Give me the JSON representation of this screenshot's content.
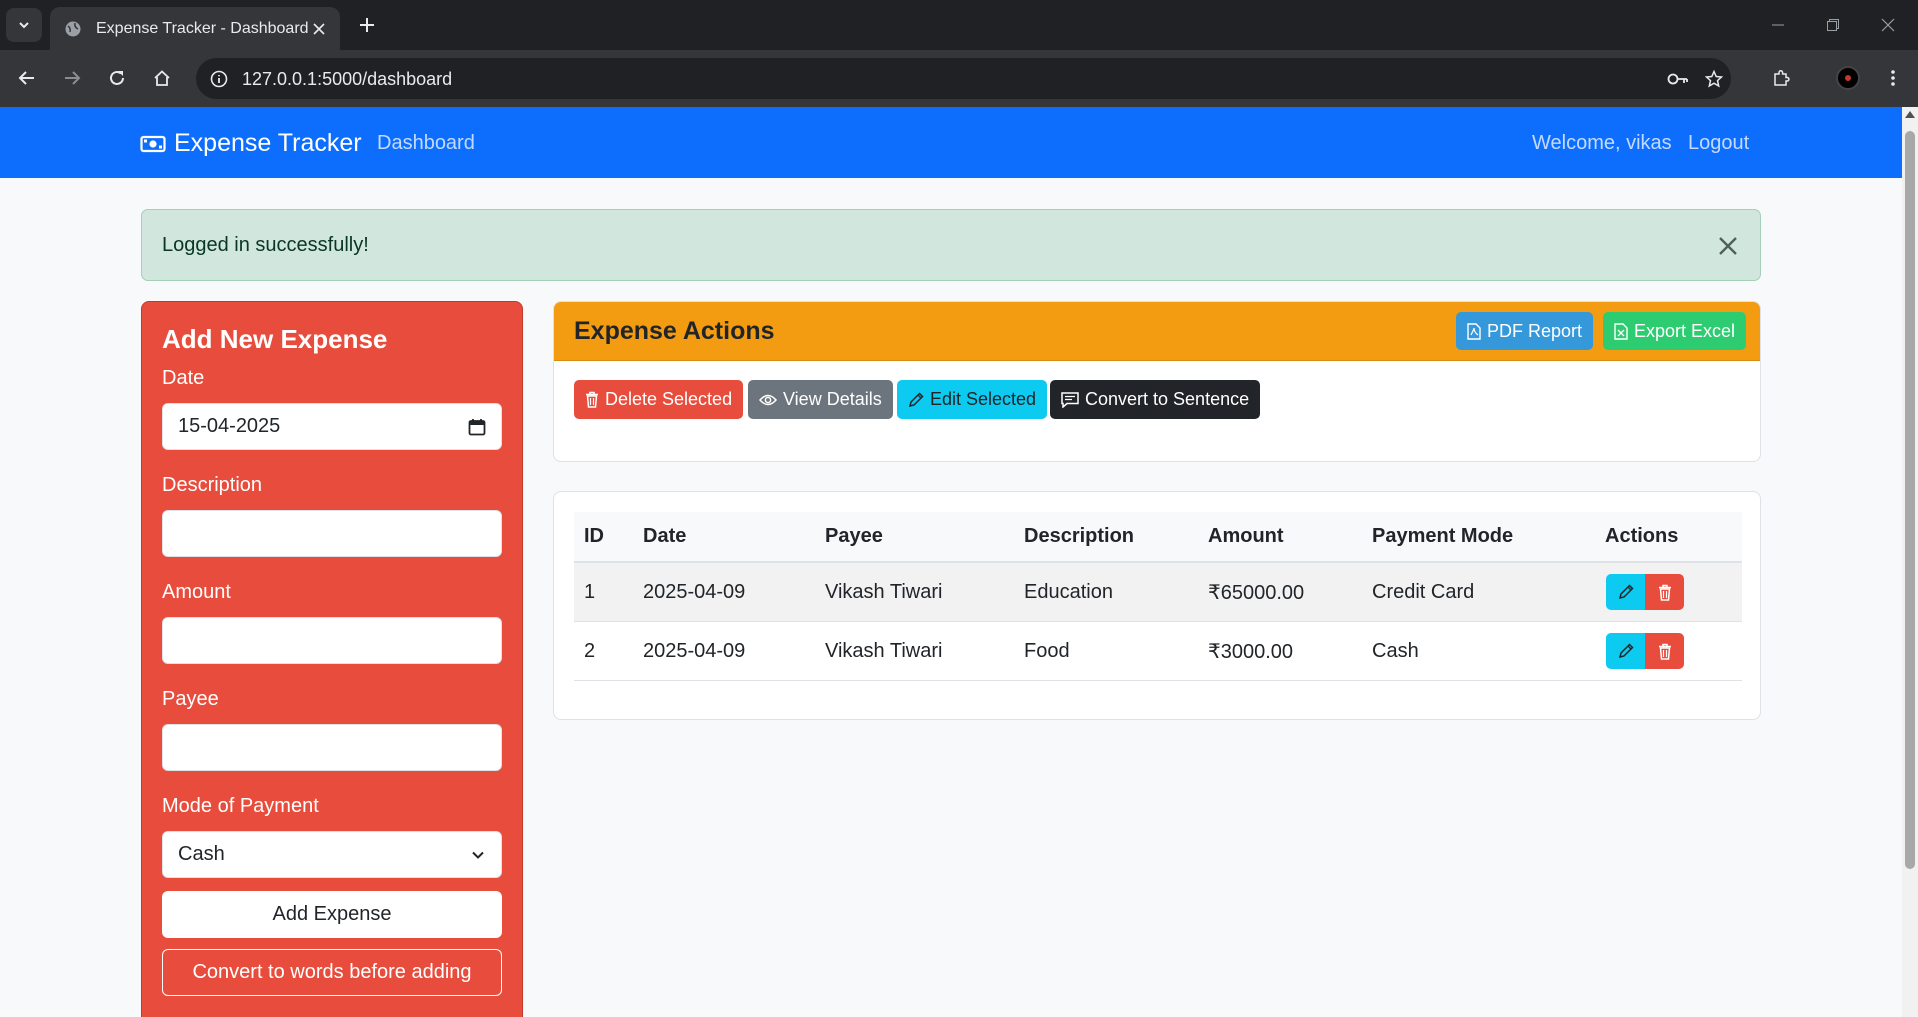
{
  "browser": {
    "tab_title": "Expense Tracker - Dashboard",
    "url": "127.0.0.1:5000/dashboard"
  },
  "navbar": {
    "brand": "Expense Tracker",
    "dashboard_link": "Dashboard",
    "welcome": "Welcome, vikas",
    "logout": "Logout"
  },
  "alert": {
    "message": "Logged in successfully!"
  },
  "form": {
    "title": "Add New Expense",
    "date_label": "Date",
    "date_value": "15-04-2025",
    "description_label": "Description",
    "description_value": "",
    "amount_label": "Amount",
    "amount_value": "",
    "payee_label": "Payee",
    "payee_value": "",
    "mode_label": "Mode of Payment",
    "mode_value": "Cash",
    "add_button": "Add Expense",
    "convert_button": "Convert to words before adding"
  },
  "actions": {
    "title": "Expense Actions",
    "pdf_button": "PDF Report",
    "excel_button": "Export Excel",
    "delete_button": "Delete Selected",
    "view_button": "View Details",
    "edit_button": "Edit Selected",
    "sentence_button": "Convert to Sentence"
  },
  "table": {
    "headers": [
      "ID",
      "Date",
      "Payee",
      "Description",
      "Amount",
      "Payment Mode",
      "Actions"
    ],
    "rows": [
      {
        "id": "1",
        "date": "2025-04-09",
        "payee": "Vikash Tiwari",
        "description": "Education",
        "amount": "₹65000.00",
        "mode": "Credit Card"
      },
      {
        "id": "2",
        "date": "2025-04-09",
        "payee": "Vikash Tiwari",
        "description": "Food",
        "amount": "₹3000.00",
        "mode": "Cash"
      }
    ]
  },
  "colors": {
    "navbar": "#0d6efd",
    "form_card": "#e74c3c",
    "actions_header": "#f39c12",
    "pdf_button": "#3498db",
    "excel_button": "#2ecc71",
    "delete_button": "#e74c3c",
    "view_button": "#6c757d",
    "edit_button": "#0dcaf0",
    "sentence_button": "#212529",
    "alert_bg": "#d1e7dd"
  }
}
